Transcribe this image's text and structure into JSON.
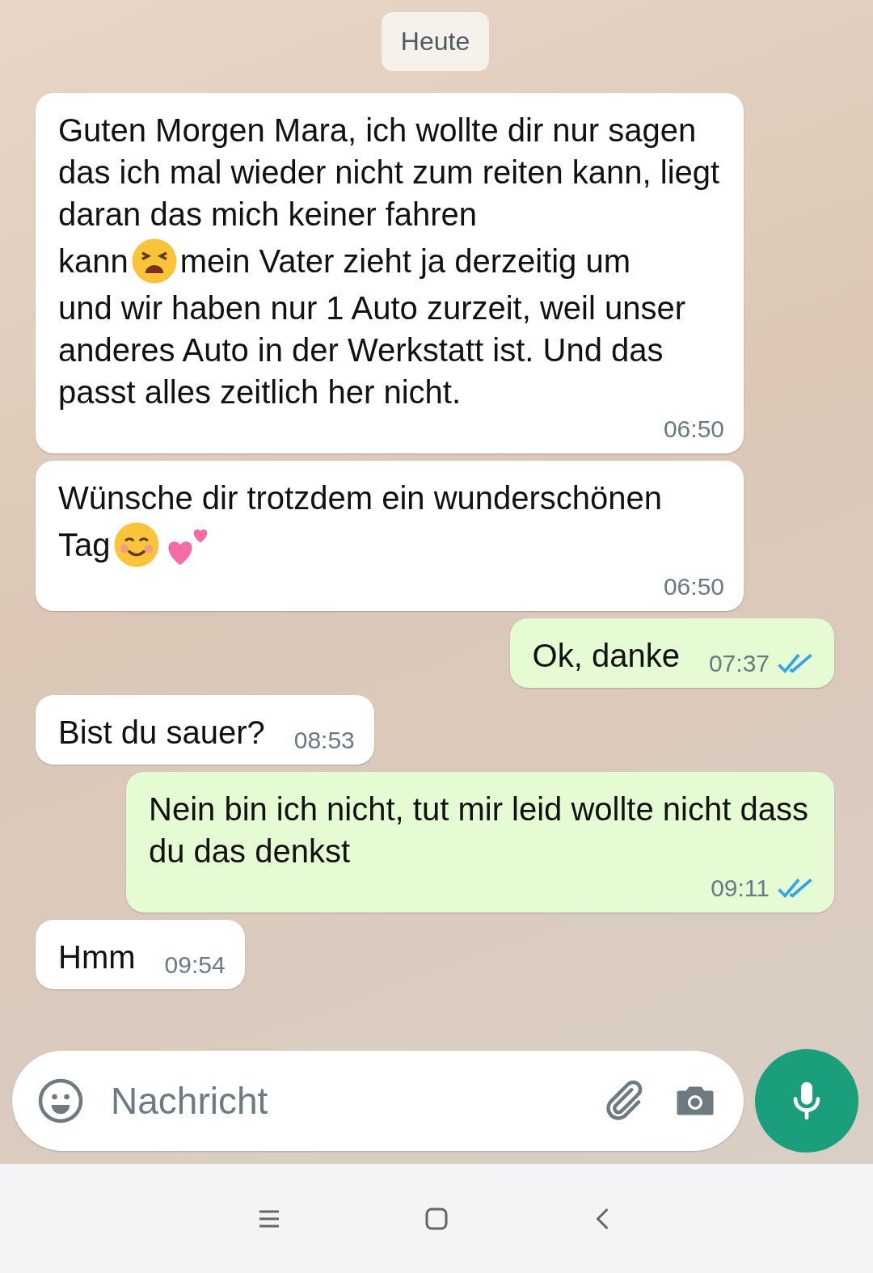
{
  "date_chip": "Heute",
  "messages": [
    {
      "kind": "incoming",
      "segments": [
        {
          "kind": "text",
          "text": "Guten Morgen Mara, ich wollte dir nur sagen das ich mal wieder nicht zum reiten kann, liegt daran das mich keiner fahren"
        },
        {
          "kind": "text",
          "text": "kann"
        },
        {
          "kind": "tired_face"
        },
        {
          "kind": "text",
          "text": "mein Vater zieht ja derzeitig um"
        },
        {
          "kind": "text",
          "text": "und wir haben nur 1 Auto zurzeit, weil unser anderes Auto in der Werkstatt ist. Und das passt alles zeitlich her nicht."
        }
      ],
      "time": "06:50"
    },
    {
      "kind": "incoming",
      "segments": [
        {
          "kind": "text",
          "text": "Wünsche dir trotzdem ein wunderschönen"
        },
        {
          "kind": "text",
          "text": "Tag"
        },
        {
          "kind": "smiling_face"
        },
        {
          "kind": "hearts"
        }
      ],
      "time": "06:50"
    },
    {
      "kind": "outgoing",
      "segments": [
        {
          "kind": "text",
          "text": "Ok, danke"
        }
      ],
      "time": "07:37",
      "read": true
    },
    {
      "kind": "incoming",
      "segments": [
        {
          "kind": "text",
          "text": "Bist du sauer?"
        }
      ],
      "time": "08:53"
    },
    {
      "kind": "outgoing",
      "segments": [
        {
          "kind": "text",
          "text": "Nein bin ich nicht, tut mir leid wollte nicht dass du das denkst"
        }
      ],
      "time": "09:11",
      "read": true
    },
    {
      "kind": "incoming",
      "segments": [
        {
          "kind": "text",
          "text": "Hmm"
        }
      ],
      "time": "09:54"
    }
  ],
  "composer": {
    "placeholder": "Nachricht"
  }
}
